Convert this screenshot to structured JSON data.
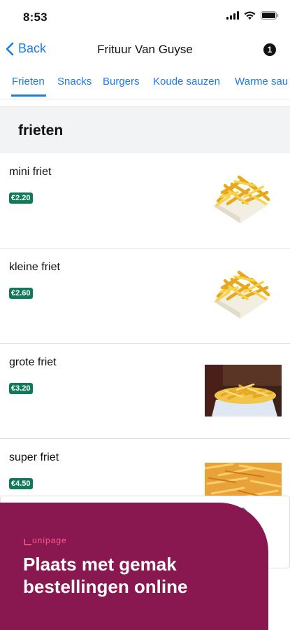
{
  "status_bar": {
    "time": "8:53"
  },
  "nav": {
    "back_label": "Back",
    "title": "Frituur Van Guyse",
    "cart_count": "1"
  },
  "tabs": [
    {
      "label": "Frieten",
      "active": true
    },
    {
      "label": "Snacks"
    },
    {
      "label": "Burgers"
    },
    {
      "label": "Koude sauzen"
    },
    {
      "label": "Warme sau"
    }
  ],
  "section": {
    "title": "frieten"
  },
  "items": [
    {
      "name": "mini friet",
      "price": "€2.20"
    },
    {
      "name": "kleine friet",
      "price": "€2.60"
    },
    {
      "name": "grote friet",
      "price": "€3.20"
    },
    {
      "name": "super friet",
      "price": "€4.50"
    }
  ],
  "promo": {
    "brand": "unipage",
    "headline_line1": "Plaats met gemak",
    "headline_line2": "bestellingen online"
  },
  "colors": {
    "accent": "#1a7cf0",
    "price_badge": "#0e7a5a",
    "promo_bg": "#8a1850",
    "promo_brand": "#ff5a8a"
  }
}
